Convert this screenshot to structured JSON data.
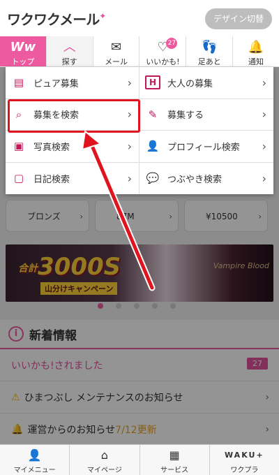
{
  "header": {
    "logo": "ワクワクメール",
    "design_button": "デザイン切替"
  },
  "nav": {
    "items": [
      {
        "label": "トップ",
        "icon": "ww-logo-icon",
        "glyph": "Ww"
      },
      {
        "label": "探す",
        "icon": "chevron-up-icon",
        "glyph": "︿"
      },
      {
        "label": "メール",
        "icon": "mail-icon",
        "glyph": "✉"
      },
      {
        "label": "いいかも!",
        "icon": "heart-icon",
        "glyph": "♡",
        "badge": "27"
      },
      {
        "label": "足あと",
        "icon": "footprints-icon",
        "glyph": "👣"
      },
      {
        "label": "通知",
        "icon": "bell-icon",
        "glyph": "🔔"
      }
    ]
  },
  "menu": {
    "items": [
      {
        "label": "ピュア募集",
        "icon": "document-icon",
        "glyph": "▤"
      },
      {
        "label": "大人の募集",
        "icon": "h-icon",
        "glyph": "H"
      },
      {
        "label": "募集を検索",
        "icon": "search-document-icon",
        "glyph": "⌕"
      },
      {
        "label": "募集する",
        "icon": "compose-icon",
        "glyph": "✎"
      },
      {
        "label": "写真検索",
        "icon": "photo-search-icon",
        "glyph": "▣"
      },
      {
        "label": "プロフィール検索",
        "icon": "profile-search-icon",
        "glyph": "👤"
      },
      {
        "label": "日記検索",
        "icon": "diary-search-icon",
        "glyph": "▢"
      },
      {
        "label": "つぶやき検索",
        "icon": "chat-search-icon",
        "glyph": "💬"
      }
    ]
  },
  "background": {
    "rank_cards": [
      {
        "label": "ブロンズ"
      },
      {
        "label": "87M"
      },
      {
        "label": "¥10500"
      }
    ],
    "banner": {
      "headline": "3000S",
      "prefix": "合計",
      "sub": "山分けキャンペーン",
      "game": "Vampire Blood"
    },
    "news": {
      "title": "新着情報",
      "rows": [
        {
          "text": "いいかも!されました",
          "count": "27"
        },
        {
          "text": "ひまつぶし メンテナンスのお知らせ"
        },
        {
          "text": "運営からのお知らせ",
          "date": "7/12更新"
        }
      ]
    }
  },
  "bottom_nav": {
    "items": [
      {
        "label": "マイメニュー",
        "icon": "person-icon",
        "glyph": "👤"
      },
      {
        "label": "マイページ",
        "icon": "home-icon",
        "glyph": "⌂"
      },
      {
        "label": "サービス",
        "icon": "grid-icon",
        "glyph": "▦"
      },
      {
        "label": "ワクプラ",
        "icon": "waku-plus-logo",
        "glyph": "WAKU+"
      }
    ]
  },
  "colors": {
    "accent": "#ee5aa0",
    "annotation": "#e0141e"
  }
}
